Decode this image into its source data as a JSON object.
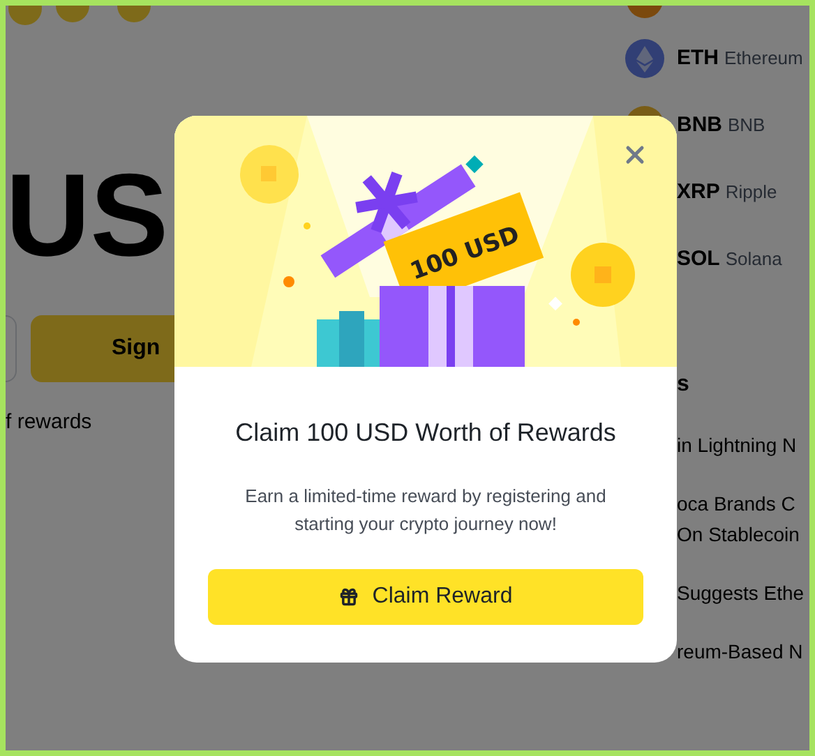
{
  "background": {
    "hero_text": "US",
    "signup_button": "Sign",
    "rewards_text": "f rewards",
    "coins": [
      {
        "symbol": "ETH",
        "name": "Ethereum"
      },
      {
        "symbol": "BNB",
        "name": "BNB"
      },
      {
        "symbol": "XRP",
        "name": "Ripple"
      },
      {
        "symbol": "SOL",
        "name": "Solana"
      }
    ],
    "news_heading": "s",
    "news": [
      {
        "lines": [
          "in Lightning N"
        ]
      },
      {
        "lines": [
          "oca Brands C",
          "On Stablecoin"
        ]
      },
      {
        "lines": [
          "Suggests Ethe"
        ]
      },
      {
        "lines": [
          "reum-Based N"
        ]
      }
    ]
  },
  "modal": {
    "ticket_text": "100 USD",
    "title": "Claim 100 USD Worth of Rewards",
    "text": "Earn a limited-time reward by registering and starting your crypto journey now!",
    "button": "Claim Reward"
  }
}
